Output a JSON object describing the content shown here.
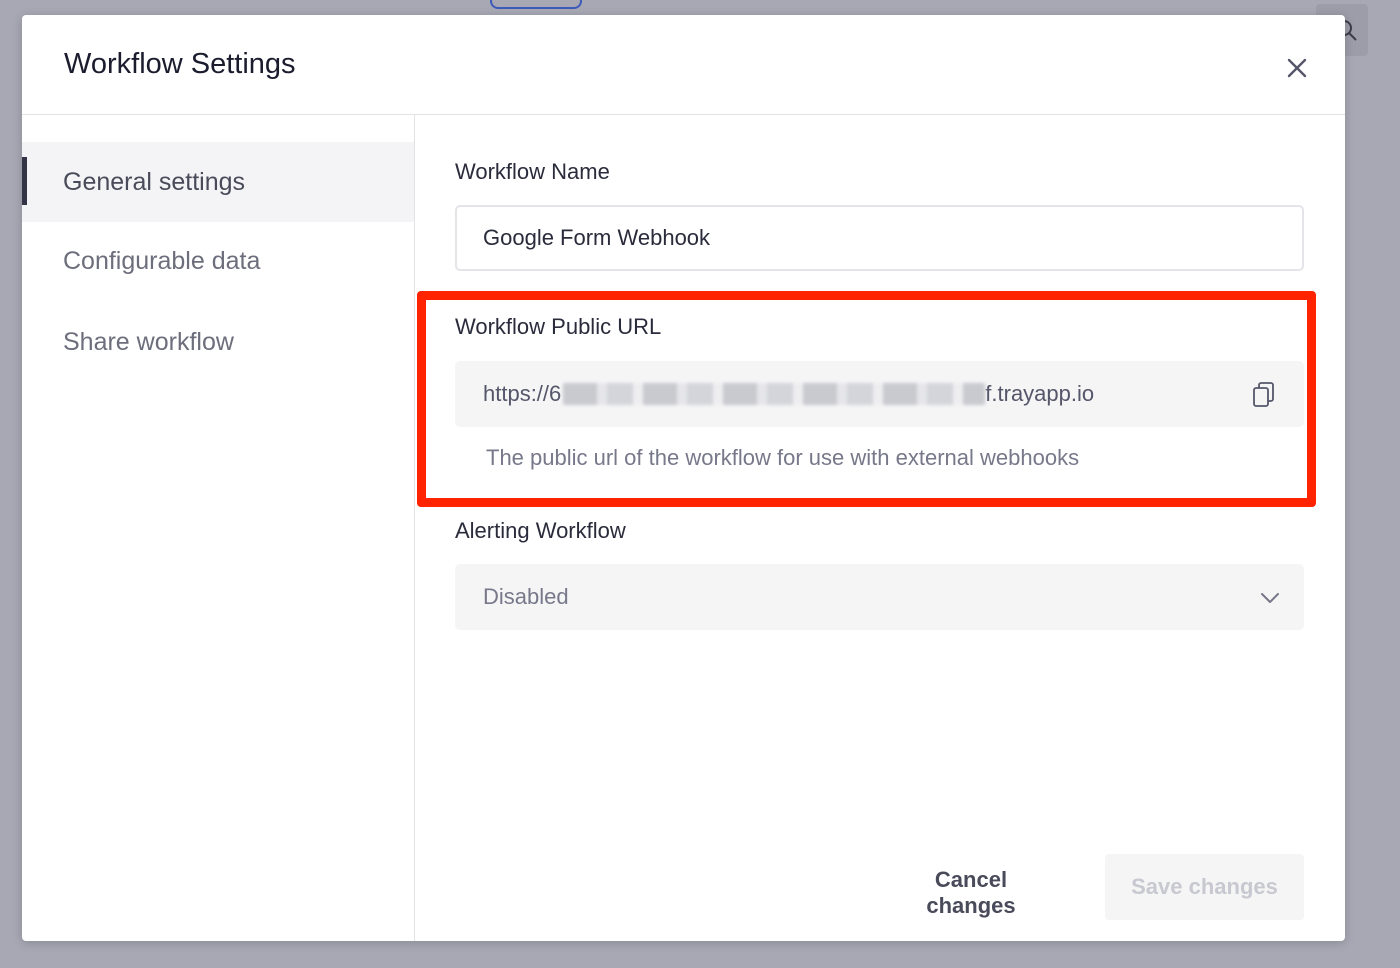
{
  "modal": {
    "title": "Workflow Settings",
    "close_icon": "close-icon"
  },
  "sidebar": {
    "items": [
      {
        "label": "General settings",
        "active": true
      },
      {
        "label": "Configurable data",
        "active": false
      },
      {
        "label": "Share workflow",
        "active": false
      }
    ]
  },
  "general": {
    "workflow_name": {
      "label": "Workflow Name",
      "value": "Google Form Webhook"
    },
    "public_url": {
      "label": "Workflow Public URL",
      "value_prefix": "https://6",
      "value_suffix": "f.trayapp.io",
      "helper": "The public url of the workflow for use with external webhooks",
      "copy_icon": "copy-icon"
    },
    "alerting": {
      "label": "Alerting Workflow",
      "selected": "Disabled",
      "icon": "chevron-down-icon"
    }
  },
  "footer": {
    "cancel_label": "Cancel changes",
    "save_label": "Save changes"
  },
  "colors": {
    "highlight": "#ff2300",
    "backdrop": "#a7a8b4"
  }
}
